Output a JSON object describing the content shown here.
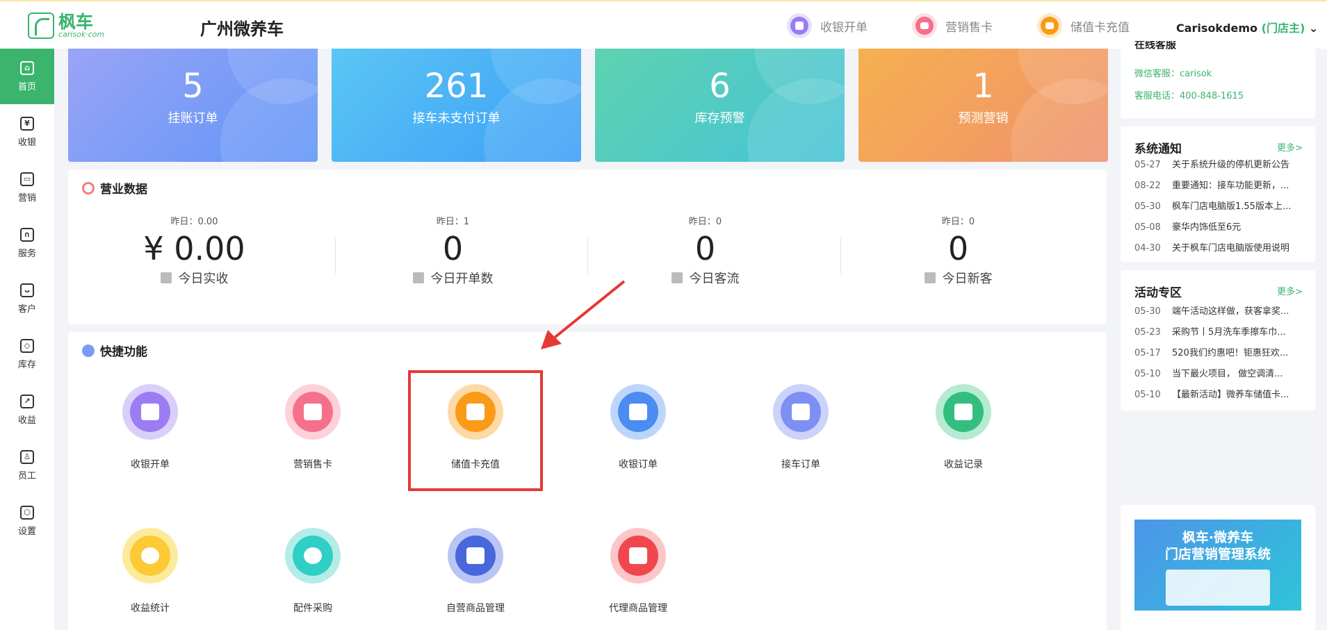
{
  "header": {
    "logo_cn": "枫车",
    "logo_en": "carisok·com",
    "store_name": "广州微养车",
    "actions": [
      {
        "label": "收银开单",
        "color": "#9b7cf2",
        "ring": "#e8e1fb"
      },
      {
        "label": "营销售卡",
        "color": "#f5708a",
        "ring": "#fde0e6"
      },
      {
        "label": "储值卡充值",
        "color": "#fb9a17",
        "ring": "#fee8c8"
      }
    ],
    "user": "Carisokdemo",
    "user_role": "(门店主)"
  },
  "sidebar": [
    {
      "label": "首页",
      "glyph": "⌂"
    },
    {
      "label": "收银",
      "glyph": "¥"
    },
    {
      "label": "营销",
      "glyph": "▭"
    },
    {
      "label": "服务",
      "glyph": "∩"
    },
    {
      "label": "客户",
      "glyph": "ᴗ"
    },
    {
      "label": "库存",
      "glyph": "◇"
    },
    {
      "label": "收益",
      "glyph": "↗"
    },
    {
      "label": "员工",
      "glyph": "♙"
    },
    {
      "label": "设置",
      "glyph": "⬡"
    }
  ],
  "cards": [
    {
      "value": "5",
      "label": "挂账订单",
      "from": "#9aa4f6",
      "to": "#5f95f7"
    },
    {
      "value": "261",
      "label": "接车未支付订单",
      "from": "#5ac6f5",
      "to": "#3d9ef6"
    },
    {
      "value": "6",
      "label": "库存预警",
      "from": "#5dd3b0",
      "to": "#46c2d8"
    },
    {
      "value": "1",
      "label": "预测营销",
      "from": "#f6b04f",
      "to": "#f0916e"
    }
  ],
  "business": {
    "title": "营业数据",
    "stats": [
      {
        "yesterday": "昨日：0.00",
        "value": "¥ 0.00",
        "label": "今日实收"
      },
      {
        "yesterday": "昨日：1",
        "value": "0",
        "label": "今日开单数"
      },
      {
        "yesterday": "昨日：0",
        "value": "0",
        "label": "今日客流"
      },
      {
        "yesterday": "昨日：0",
        "value": "0",
        "label": "今日新客"
      }
    ]
  },
  "quick": {
    "title": "快捷功能",
    "tools": [
      {
        "label": "收银开单",
        "ring": "#d9cffa",
        "inner": "#9b7cf2"
      },
      {
        "label": "营销售卡",
        "ring": "#fdd0da",
        "inner": "#f5708a"
      },
      {
        "label": "储值卡充值",
        "ring": "#fed9a6",
        "inner": "#fb9a17"
      },
      {
        "label": "收银订单",
        "ring": "#bcd6fb",
        "inner": "#4a8cf1"
      },
      {
        "label": "接车订单",
        "ring": "#cbd3fb",
        "inner": "#7d8ff3"
      },
      {
        "label": "收益记录",
        "ring": "#b6ead2",
        "inner": "#33be7f"
      },
      {
        "label": "收益统计",
        "ring": "#fdeb9c",
        "inner": "#fdc935"
      },
      {
        "label": "配件采购",
        "ring": "#b4ece8",
        "inner": "#2fcfc6"
      },
      {
        "label": "自营商品管理",
        "ring": "#b9c5f4",
        "inner": "#4867dd"
      },
      {
        "label": "代理商品管理",
        "ring": "#fcc6c8",
        "inner": "#f0474f"
      }
    ]
  },
  "service": {
    "title": "在线客服",
    "wechat": "微信客服：carisok",
    "phone": "客服电话：400-848-1615"
  },
  "notices": {
    "title": "系统通知",
    "more": "更多>",
    "items": [
      {
        "date": "05-27",
        "text": "关于系统升级的停机更新公告"
      },
      {
        "date": "08-22",
        "text": "重要通知：接车功能更新，..."
      },
      {
        "date": "05-30",
        "text": "枫车门店电脑版1.55版本上..."
      },
      {
        "date": "05-08",
        "text": "豪华内饰低至6元"
      },
      {
        "date": "04-30",
        "text": "关于枫车门店电脑版使用说明"
      }
    ]
  },
  "activities": {
    "title": "活动专区",
    "more": "更多>",
    "items": [
      {
        "date": "05-30",
        "text": "端午活动这样做，获客拿奖..."
      },
      {
        "date": "05-23",
        "text": "采购节丨5月洗车季擦车巾..."
      },
      {
        "date": "05-17",
        "text": "520我们约惠吧！钜惠狂欢..."
      },
      {
        "date": "05-10",
        "text": "当下最火项目， 做空调清..."
      },
      {
        "date": "05-10",
        "text": "【最新活动】微养车储值卡..."
      }
    ]
  },
  "banner": {
    "line1": "枫车·微养车",
    "line2": "门店营销管理系统"
  },
  "annotation": {
    "highlight_color": "#e53935"
  }
}
